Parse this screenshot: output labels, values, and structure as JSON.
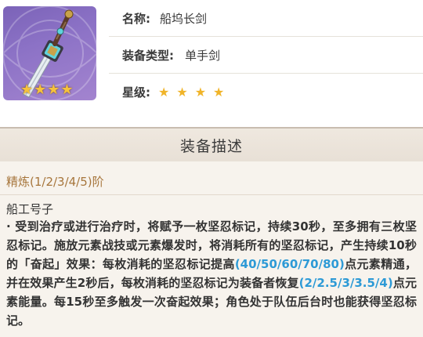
{
  "item": {
    "fields": [
      {
        "label": "名称:",
        "value": "船坞长剑"
      },
      {
        "label": "装备类型:",
        "value": "单手剑"
      },
      {
        "label": "星级:",
        "stars": 4
      }
    ],
    "thumbnail_stars": 4
  },
  "section": {
    "title": "装备描述"
  },
  "refinement": {
    "label": "精炼(1/2/3/4/5)阶"
  },
  "skill": {
    "name": "船工号子",
    "desc_1": "· 受到治疗或进行治疗时，将赋予一枚坚忍标记，持续30秒，至多拥有三枚坚忍标记。施放元素战技或元素爆发时，将消耗所有的坚忍标记，产生持续10秒的「奋起」效果：每枚消耗的坚忍标记提高",
    "values_1": "(40/50/60/70/80)",
    "desc_2": "点元素精通，并在效果产生2秒后，每枚消耗的坚忍标记为装备者恢复",
    "values_2": "(2/2.5/3/3.5/4)",
    "desc_3": "点元素能量。每15秒至多触发一次奋起效果；角色处于队伍后台时也能获得坚忍标记。"
  },
  "colors": {
    "highlight": "#2d9ad6",
    "refine_text": "#a7763c",
    "star": "#f0b429",
    "thumb_bg": "#8c72c6"
  },
  "icons": [
    "sword-thumbnail",
    "star-icon"
  ]
}
